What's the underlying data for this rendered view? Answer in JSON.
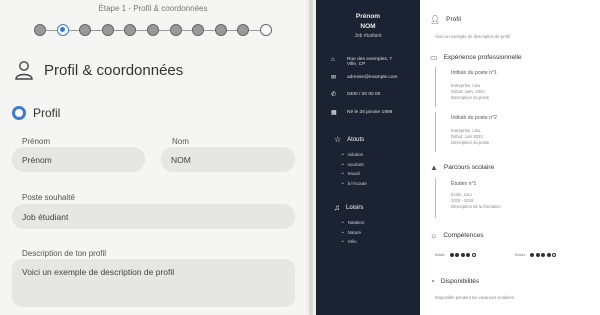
{
  "stepper": {
    "label": "Étape 1 - Profil & coordonnées",
    "count": 11,
    "active": 1
  },
  "section": {
    "title": "Profil & coordonnées",
    "subtitle": "Profil"
  },
  "form": {
    "firstname": {
      "label": "Prénom",
      "value": "Prénom"
    },
    "lastname": {
      "label": "Nom",
      "value": "NOM"
    },
    "position": {
      "label": "Poste souhaité",
      "value": "Job étudiant"
    },
    "description": {
      "label": "Description de ton profil",
      "value": "Voici un exemple de description de profil"
    }
  },
  "cv": {
    "firstname": "Prénom",
    "lastname": "NOM",
    "job": "Job étudiant",
    "contact": {
      "address_line1": "Rue des exemples, 7",
      "address_line2": "Ville, CP",
      "email": "adresse@example.com",
      "phone": "0400 / 00 00 00",
      "birth": "Né le 26 janvier 1998"
    },
    "atouts": {
      "title": "Atouts",
      "items": [
        "solution",
        "souriant",
        "travail",
        "à l'écoute"
      ]
    },
    "loisirs": {
      "title": "Loisirs",
      "items": [
        "Natation",
        "Nature",
        "Vélo"
      ]
    },
    "profil": {
      "title": "Profil",
      "text": "Voici un exemple de description de profil"
    },
    "experience": {
      "title": "Expérience professionnelle",
      "items": [
        {
          "title": "Intitulé du poste n°1",
          "company": "Entreprise, Lieu",
          "start": "Début: Janv. 2024",
          "desc": "Description du poste"
        },
        {
          "title": "Intitulé du poste n°2",
          "company": "Entreprise, Lieu",
          "start": "Début: Juin 2023",
          "desc": "Description du poste"
        }
      ]
    },
    "education": {
      "title": "Parcours scolaire",
      "items": [
        {
          "title": "Études n°1",
          "school": "École, Lieu",
          "years": "2018 - 2019",
          "desc": "Description de la formation"
        }
      ]
    },
    "skills": {
      "title": "Compétences",
      "items": [
        {
          "name": "Word",
          "level": 4,
          "max": 5
        },
        {
          "name": "Excel",
          "level": 4,
          "max": 5
        }
      ]
    },
    "availability": {
      "title": "Disponibilités",
      "text": "Disponible pendant les vacances scolaires"
    }
  }
}
